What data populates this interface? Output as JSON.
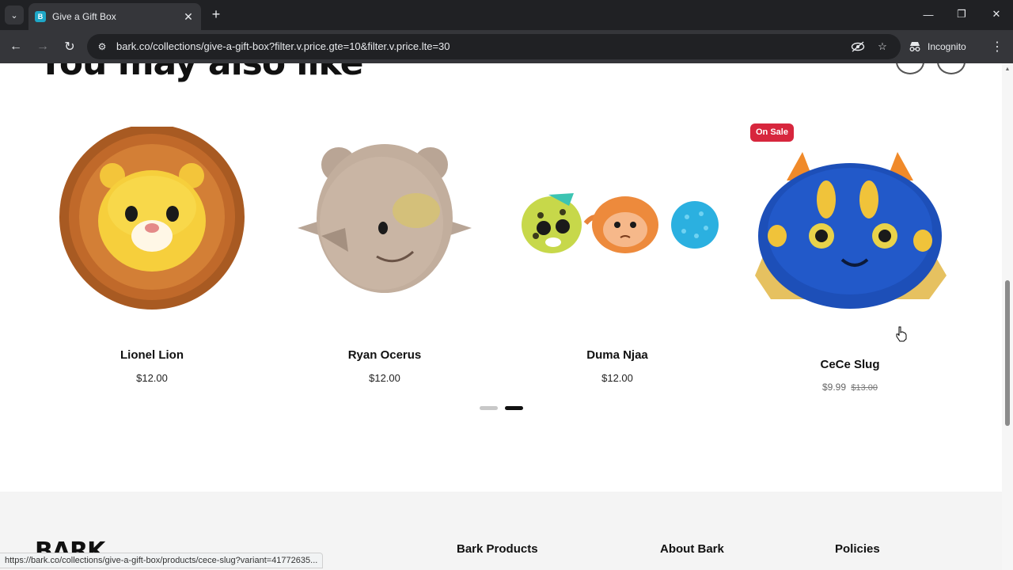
{
  "browser": {
    "tab_title": "Give a Gift Box",
    "url": "bark.co/collections/give-a-gift-box?filter.v.price.gte=10&filter.v.price.lte=30",
    "incognito_label": "Incognito",
    "status_url": "https://bark.co/collections/give-a-gift-box/products/cece-slug?variant=41772635..."
  },
  "section": {
    "heading": "You may also like"
  },
  "products": [
    {
      "name": "Lionel Lion",
      "price": "$12.00",
      "image": "lion-plush-toy"
    },
    {
      "name": "Ryan Ocerus",
      "price": "$12.00",
      "image": "rhino-plush-toy"
    },
    {
      "name": "Duma Njaa",
      "price": "$12.00",
      "image": "cheetah-monkey-ball-toy-set"
    },
    {
      "name": "CeCe Slug",
      "sale_price": "$9.99",
      "original_price": "$13.00",
      "badge": "On Sale",
      "image": "sea-slug-plush-toy"
    }
  ],
  "pagination": {
    "total": 2,
    "active": 2
  },
  "footer": {
    "logo": "BARK",
    "columns": [
      "Bark Products",
      "About Bark",
      "Policies"
    ]
  },
  "colors": {
    "sale_badge": "#d7263d",
    "footer_bg": "#f4f4f4",
    "chrome_dark": "#202124",
    "chrome_toolbar": "#35363a"
  }
}
